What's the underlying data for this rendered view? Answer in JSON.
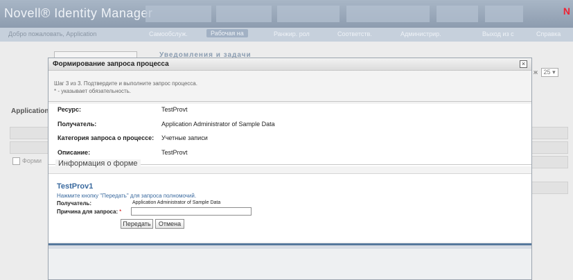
{
  "app": {
    "title": "Novell® Identity Manager",
    "corner_mark": "N"
  },
  "nav": {
    "welcome": "Добро пожаловать, Application",
    "tabs": [
      {
        "label": "Самообслуж."
      },
      {
        "label": "Рабочая на"
      },
      {
        "label": "Ранжир. рол"
      },
      {
        "label": "Соответств."
      },
      {
        "label": "Администрир."
      },
      {
        "label": "Выход из с"
      },
      {
        "label": "Справка"
      }
    ]
  },
  "background": {
    "tasks_heading": "Уведомления и задачи",
    "application_label": "Application",
    "form_checkbox_label": "Форми",
    "pager_label": "ж",
    "pager_value": "25"
  },
  "dialog": {
    "title": "Формирование запроса процесса",
    "step_line1": "Шаг 3 из 3. Подтвердите и выполните запрос процесса.",
    "step_line2": "* - указывает обязательность.",
    "close_label": "×",
    "details": [
      {
        "label": "Ресурс:",
        "value": "TestProvt"
      },
      {
        "label": "Получатель:",
        "value": "Application Administrator of Sample Data"
      },
      {
        "label": "Категория запроса о процессе:",
        "value": "Учетные записи"
      },
      {
        "label": "Описание:",
        "value": "TestProvt"
      }
    ],
    "form_section_label": "Информация о форме",
    "form": {
      "name": "TestProv1",
      "hint": "Нажмите кнопку \"Передать\" для запроса полномочий.",
      "recipient_label": "Получатель:",
      "recipient_value": "Application Administrator of Sample Data",
      "reason_label": "Причина для запроса:",
      "required_mark": "*",
      "reason_value": "",
      "submit_label": "Передать",
      "cancel_label": "Отмена"
    }
  },
  "colors": {
    "header": "#8d9caf",
    "accent_link": "#39699e",
    "footer_bar": "#56789c"
  }
}
